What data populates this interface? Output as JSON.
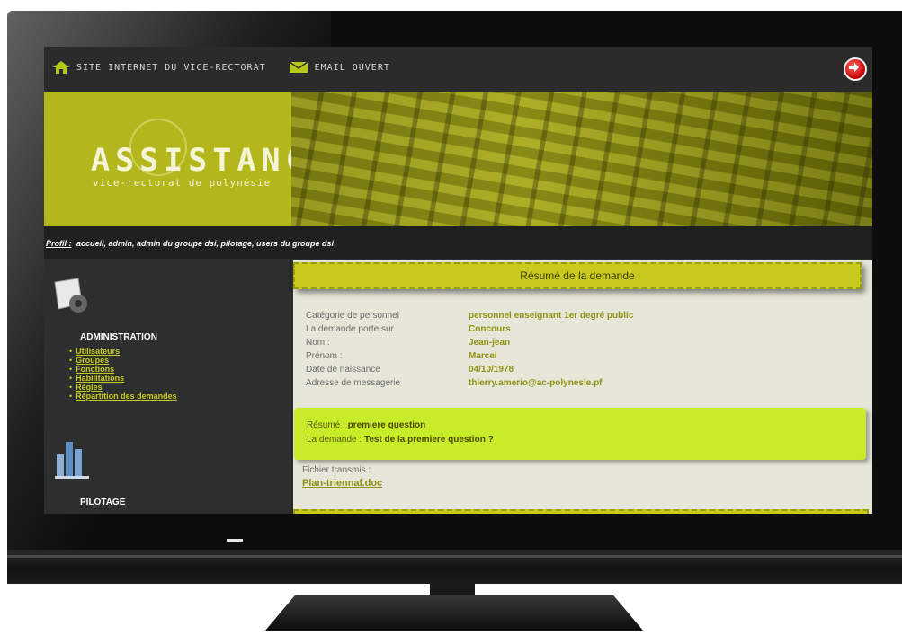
{
  "topnav": {
    "site_link": "SITE INTERNET DU VICE-RECTORAT",
    "mail_link": "EMAIL OUVERT"
  },
  "banner": {
    "title": "ASSISTANCE",
    "subtitle": "vice-rectorat de polynésie"
  },
  "profile": {
    "label": "Profil :",
    "value": "accueil, admin, admin du groupe dsi, pilotage, users du groupe dsi"
  },
  "sidebar": {
    "admin_title": "ADMINISTRATION",
    "admin_items": [
      {
        "label": "Utilisateurs"
      },
      {
        "label": "Groupes"
      },
      {
        "label": "Fonctions"
      },
      {
        "label": "Habilitations"
      },
      {
        "label": "Règles"
      },
      {
        "label": "Répartition des demandes"
      }
    ],
    "pilot_title": "PILOTAGE"
  },
  "summary": {
    "header": "Résumé de la demande",
    "fields": [
      {
        "key": "Catégorie de personnel",
        "value": "personnel enseignant 1er degré public"
      },
      {
        "key": "La demande porte sur",
        "value": "Concours"
      },
      {
        "key": "Nom :",
        "value": "Jean-jean"
      },
      {
        "key": "Prénom :",
        "value": "Marcel"
      },
      {
        "key": "Date de naissance",
        "value": "04/10/1978"
      },
      {
        "key": "Adresse de messagerie",
        "value": "thierry.amerio@ac-polynesie.pf"
      }
    ],
    "resume_label": "Résumé :",
    "resume_value": "premiere question",
    "demande_label": "La demande :",
    "demande_value": "Test de la premiere question ?",
    "file_label": "Fichier transmis :",
    "file_name": "Plan-triennal.doc"
  },
  "colors": {
    "accent": "#c8cb1e",
    "highlight": "#c8ec2a",
    "value_text": "#8f9112"
  }
}
